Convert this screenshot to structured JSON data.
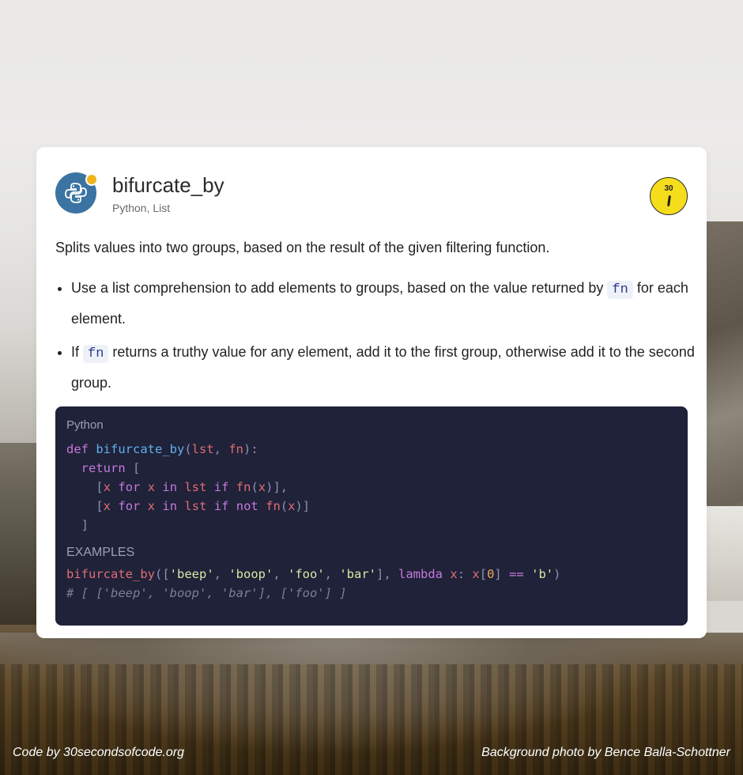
{
  "snippet": {
    "title": "bifurcate_by",
    "tags": "Python, List",
    "description": "Splits values into two groups, based on the result of the given filtering function.",
    "bullet1_a": "Use a list comprehension to add elements to groups, based on the value returned by ",
    "bullet1_code": "fn",
    "bullet1_b": " for each element.",
    "bullet2_a": "If ",
    "bullet2_code": "fn",
    "bullet2_b": " returns a truthy value for any element, add it to the first group, otherwise add it to the second group.",
    "code_language": "Python",
    "examples_label": "EXAMPLES",
    "example_output": "# [ ['beep', 'boop', 'bar'], ['foo'] ]"
  },
  "site_logo": {
    "number": "30"
  },
  "footer": {
    "code_credit": "Code by 30secondsofcode.org",
    "photo_credit": "Background photo by Bence Balla-Schottner"
  },
  "colors": {
    "lang_logo_bg": "#3b74a3",
    "status_dot": "#f2b41b",
    "site_logo_bg": "#f5dd1c",
    "code_bg": "#1f2238"
  },
  "icons": {
    "language": "python-icon",
    "site": "stopwatch-icon"
  }
}
